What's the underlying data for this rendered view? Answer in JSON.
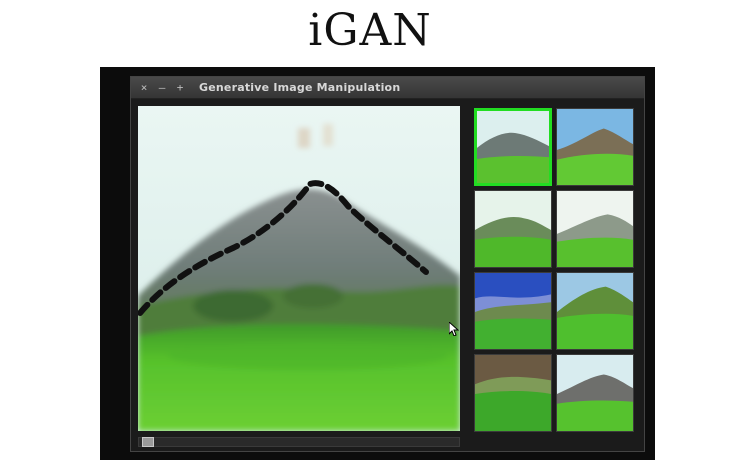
{
  "slide": {
    "title": "iGAN"
  },
  "window": {
    "title": "Generative Image Manipulation",
    "controls": [
      "close-icon",
      "minimize-icon",
      "maximize-icon"
    ]
  },
  "colors": {
    "selection_border": "#22dd22",
    "sky": "#dff0ef",
    "mountain": "#7d8a8a",
    "grass": "#55c22c",
    "stroke": "#111111"
  },
  "thumbnails": [
    {
      "selected": true
    },
    {
      "selected": false
    },
    {
      "selected": false
    },
    {
      "selected": false
    },
    {
      "selected": false
    },
    {
      "selected": false
    },
    {
      "selected": false
    },
    {
      "selected": false
    }
  ]
}
